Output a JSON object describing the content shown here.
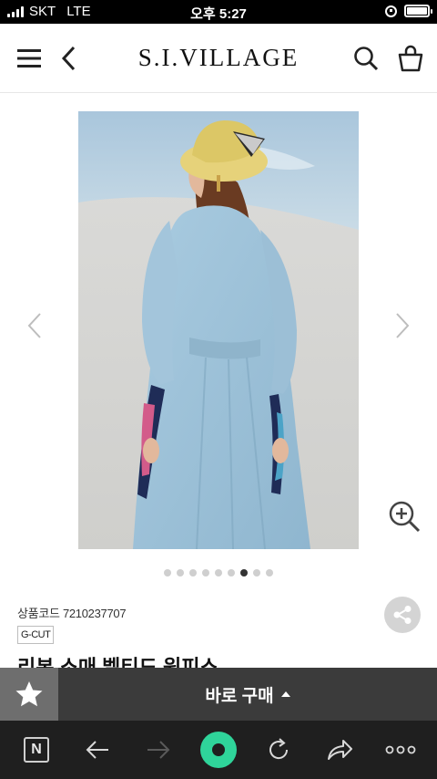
{
  "status_bar": {
    "carrier": "SKT",
    "network": "LTE",
    "time": "오후 5:27"
  },
  "header": {
    "logo": "S.I.VILLAGE",
    "icons": [
      "menu-icon",
      "back-icon",
      "search-icon",
      "shopping-bag-icon"
    ]
  },
  "gallery": {
    "image_count": 9,
    "active_index": 6,
    "icons": [
      "prev-arrow-icon",
      "next-arrow-icon",
      "zoom-in-icon"
    ]
  },
  "product": {
    "code_label": "상품코드 7210237707",
    "brand_tag": "G-CUT",
    "title": "리본 소매 벨티드 원피스"
  },
  "buy_bar": {
    "buy_label": "바로 구매",
    "icons": [
      "star-icon",
      "caret-up-icon"
    ]
  },
  "browser_toolbar": {
    "n_label": "N",
    "icons": [
      "naver-n-icon",
      "back-arrow-icon",
      "forward-arrow-icon",
      "home-icon",
      "reload-icon",
      "share-icon",
      "more-icon"
    ]
  },
  "colors": {
    "buy_bar_bg": "#3b3b3b",
    "fav_button_bg": "#6e6e6e",
    "toolbar_bg": "#1f1f1f",
    "home_accent": "#2fd49a",
    "active_dot": "#333333",
    "inactive_dot": "#cfcfcf"
  }
}
